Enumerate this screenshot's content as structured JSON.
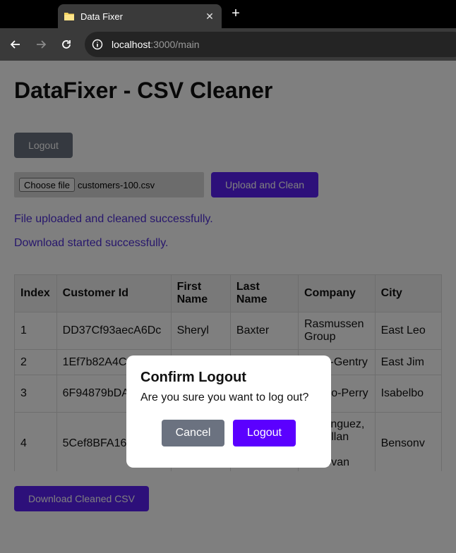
{
  "browser": {
    "tab_title": "Data Fixer",
    "url_host": "localhost",
    "url_path": ":3000/main"
  },
  "page": {
    "title": "DataFixer - CSV Cleaner",
    "logout_label": "Logout",
    "choose_file_label": "Choose file",
    "file_name": "customers-100.csv",
    "upload_label": "Upload and Clean",
    "status_upload": "File uploaded and cleaned successfully.",
    "status_download": "Download started successfully.",
    "download_label": "Download Cleaned CSV"
  },
  "table": {
    "headers": [
      "Index",
      "Customer Id",
      "First Name",
      "Last Name",
      "Company",
      "City"
    ],
    "rows": [
      [
        "1",
        "DD37Cf93aecA6Dc",
        "Sheryl",
        "Baxter",
        "Rasmussen Group",
        "East Leo"
      ],
      [
        "2",
        "1Ef7b82A4C",
        "",
        "",
        "Vega-Gentry",
        "East Jim"
      ],
      [
        "3",
        "6F94879bDA",
        "",
        "",
        "Murillo-Perry",
        "Isabelbo"
      ],
      [
        "4",
        "5Cef8BFA16",
        "",
        "",
        "Dominguez, Mcmillan and Donovan",
        "Bensonv"
      ]
    ]
  },
  "modal": {
    "title": "Confirm Logout",
    "message": "Are you sure you want to log out?",
    "cancel_label": "Cancel",
    "confirm_label": "Logout"
  },
  "colors": {
    "primary": "#5b21f5",
    "secondary": "#6b7280",
    "status_text": "#4f2ed8"
  }
}
